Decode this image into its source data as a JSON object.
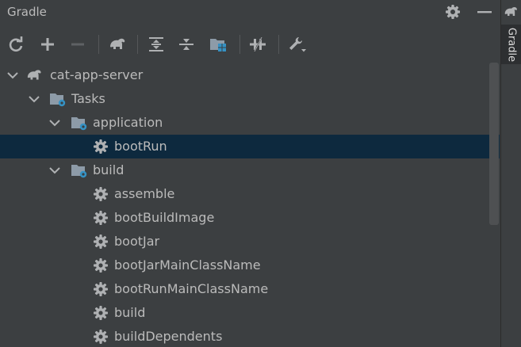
{
  "panel": {
    "title": "Gradle"
  },
  "side_tab": {
    "label": "Gradle"
  },
  "toolbar": {
    "buttons": [
      "refresh-icon",
      "add-icon",
      "remove-icon",
      "gradle-elephant-icon",
      "expand-all-icon",
      "collapse-all-icon",
      "folder-module-icon",
      "toggle-offline-icon",
      "wrench-settings-icon"
    ]
  },
  "tree": {
    "project": "cat-app-server",
    "tasks_label": "Tasks",
    "groups": [
      {
        "name": "application",
        "tasks": [
          "bootRun"
        ]
      },
      {
        "name": "build",
        "tasks": [
          "assemble",
          "bootBuildImage",
          "bootJar",
          "bootJarMainClassName",
          "bootRunMainClassName",
          "build",
          "buildDependents"
        ]
      }
    ],
    "selected": "bootRun"
  },
  "colors": {
    "background": "#3c3f41",
    "selection": "#0d293e",
    "text": "#bbbbbb",
    "folder": "#8d9ba8",
    "gear_badge": "#3592c4"
  }
}
